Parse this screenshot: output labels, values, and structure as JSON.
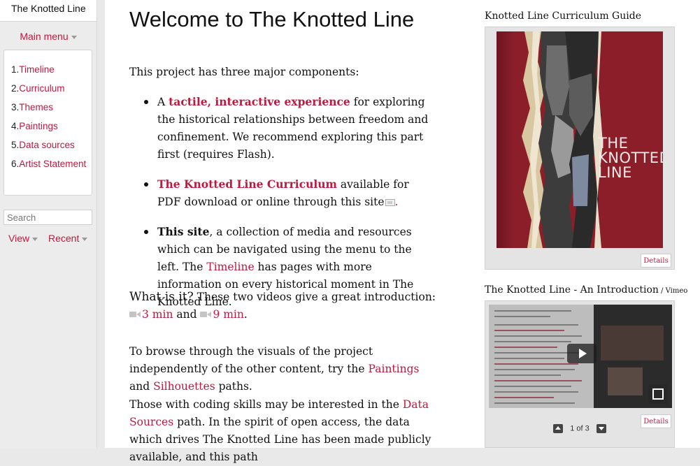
{
  "sidebar": {
    "site_title": "The Knotted Line",
    "main_menu_label": "Main menu",
    "menu_items": [
      {
        "num": "1.",
        "label": "Timeline"
      },
      {
        "num": "2.",
        "label": "Curriculum"
      },
      {
        "num": "3.",
        "label": "Themes"
      },
      {
        "num": "4.",
        "label": "Paintings"
      },
      {
        "num": "5.",
        "label": "Data sources"
      },
      {
        "num": "6.",
        "label": "Artist Statement"
      }
    ],
    "search_placeholder": "Search",
    "view_label": "View",
    "recent_label": "Recent"
  },
  "main": {
    "title": "Welcome to The Knotted Line",
    "intro": "This project has three major components:",
    "bullets": {
      "b1_prefix": "A ",
      "b1_link": "tactile, interactive experience",
      "b1_rest": " for exploring the historical relationships between freedom and confinement. We recommend exploring this part first (requires Flash).",
      "b2_link": "The Knotted Line Curriculum",
      "b2_rest": " available for PDF download or online through this site",
      "b2_end": ".",
      "b3_bold": "This site",
      "b3_rest1": ", a collection of media and resources which can be navigated using the menu to the left. The ",
      "b3_link": "Timeline",
      "b3_rest2": " has pages with more information on every historical moment in The Knotted Line."
    },
    "what": {
      "heading": "What is it?",
      "rest": " These two videos give a great introduction:",
      "video1": "3 min",
      "and": " and ",
      "video2": "9 min",
      "end": "."
    },
    "browse": {
      "prefix": "To browse through the visuals of the project independently of the other content, try the ",
      "link1": "Paintings",
      "and": " and ",
      "link2": "Silhouettes",
      "suffix": " paths."
    },
    "coding": {
      "prefix": "Those with coding skills may be interested in the ",
      "link": "Data Sources",
      "suffix": " path. In the spirit of open access, the data which drives The Knotted Line has been made publicly available, and this path"
    }
  },
  "right": {
    "guide_title": "Knotted Line Curriculum Guide",
    "cover_title": "THE KNOTTED LINE",
    "details_label": "Details",
    "video_title": "The Knotted Line - An Introduction",
    "video_source": " / Vimeo",
    "video_details_label": "Details",
    "pager_text": "1 of 3"
  }
}
